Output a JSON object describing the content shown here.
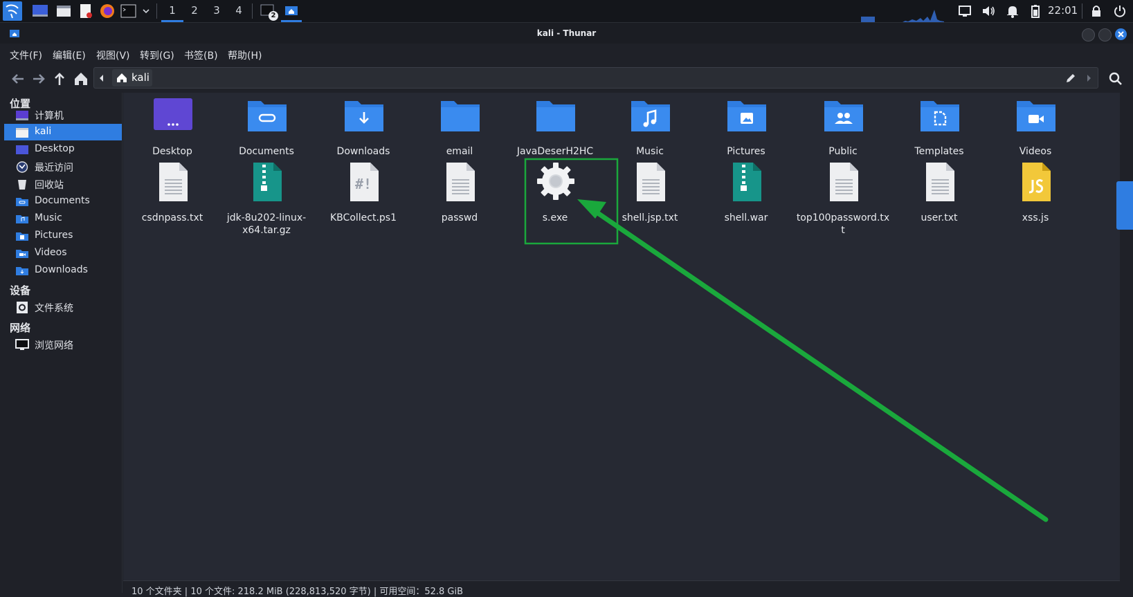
{
  "taskbar": {
    "workspaces": [
      "1",
      "2",
      "3",
      "4"
    ],
    "active_workspace": "1",
    "terminal_badge": "2",
    "clock": "22:01"
  },
  "window": {
    "title": "kali - Thunar"
  },
  "menubar": {
    "items": [
      "文件(F)",
      "编辑(E)",
      "视图(V)",
      "转到(G)",
      "书签(B)",
      "帮助(H)"
    ]
  },
  "pathbar": {
    "current": "kali"
  },
  "sidebar": {
    "places_heading": "位置",
    "places": [
      {
        "label": "计算机",
        "icon": "computer-icon"
      },
      {
        "label": "kali",
        "icon": "home-folder-icon"
      },
      {
        "label": "Desktop",
        "icon": "desktop-icon"
      },
      {
        "label": "最近访问",
        "icon": "recent-icon"
      },
      {
        "label": "回收站",
        "icon": "trash-icon"
      },
      {
        "label": "Documents",
        "icon": "documents-folder-icon"
      },
      {
        "label": "Music",
        "icon": "music-folder-icon"
      },
      {
        "label": "Pictures",
        "icon": "pictures-folder-icon"
      },
      {
        "label": "Videos",
        "icon": "videos-folder-icon"
      },
      {
        "label": "Downloads",
        "icon": "downloads-folder-icon"
      }
    ],
    "devices_heading": "设备",
    "devices": [
      {
        "label": "文件系统",
        "icon": "drive-icon"
      }
    ],
    "network_heading": "网络",
    "network": [
      {
        "label": "浏览网络",
        "icon": "network-icon"
      }
    ]
  },
  "files": {
    "row1": [
      "Desktop",
      "Documents",
      "Downloads",
      "email",
      "JavaDeserH2HC",
      "Music",
      "Pictures",
      "Public",
      "Templates",
      "Videos"
    ],
    "row2": [
      "csdnpass.txt",
      "jdk-8u202-linux-x64.tar.gz",
      "KBCollect.ps1",
      "passwd",
      "s.exe",
      "shell.jsp.txt",
      "shell.war",
      "top100password.txt",
      "user.txt",
      "xss.js"
    ]
  },
  "status": {
    "text": "10 个文件夹 | 10 个文件: 218.2 MiB (228,813,520 字节) | 可用空间：52.8 GiB"
  },
  "colors": {
    "accent": "#2f7de1",
    "folder": "#2f7de1",
    "annotation": "#1aa83c",
    "archive": "#17958a",
    "js": "#f2c83a"
  }
}
